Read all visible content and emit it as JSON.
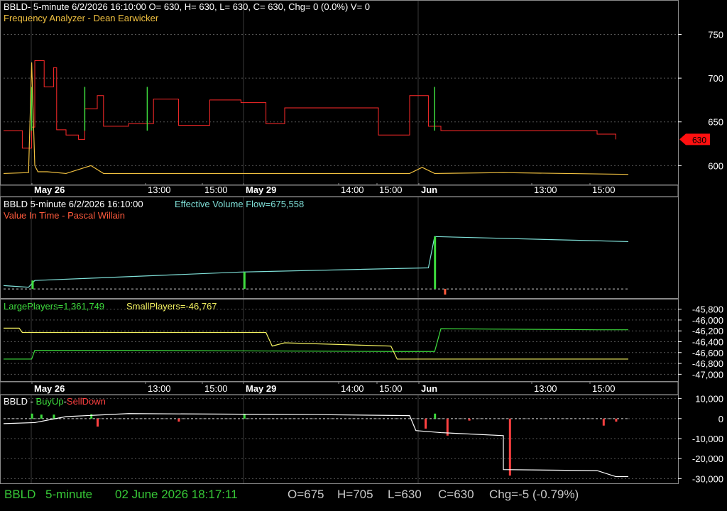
{
  "colors": {
    "background": "#000000",
    "frequency_red": "#ff2a2a",
    "frequency_green": "#3ddc3d",
    "frequency_yellow": "#f0c040",
    "flow_cyan": "#7fe0d8",
    "flow_green": "#3ddc3d",
    "flow_white": "#ffffff",
    "vit_red": "#ff5a3c",
    "large_green": "#3ddc3d",
    "small_yellow": "#f2f060",
    "buy_green": "#3ddc3d",
    "sell_red": "#ff4040",
    "status_green": "#37c837",
    "status_gray": "#c8c8c8",
    "price_tag": "#ff1010"
  },
  "panel1": {
    "title": "BBLD- 5-minute 6/2/2026 16:10:00 O= 630, H= 630, L= 630, C= 630, Chg= 0 (0.0%) V= 0",
    "indicator": "Frequency Analyzer - Dean Earwicker",
    "price_tag": "630"
  },
  "panel2": {
    "symbol": "BBLD 5-minute  6/2/2026 16:10:00",
    "flow": "Effective Volume Flow=675,558",
    "indicator": "Value In Time - Pascal Willain"
  },
  "panel3": {
    "large": "LargePlayers=1,361,749",
    "small": "SmallPlayers=-46,767"
  },
  "panel4": {
    "symbol": "BBLD -",
    "buy": "BuyUp",
    "dash": "-",
    "sell": "SellDown"
  },
  "time_axis": [
    "May 26",
    "13:00",
    "15:00",
    "May 29",
    "14:00",
    "15:00",
    "Jun",
    "13:00",
    "15:00"
  ],
  "status": {
    "symbol": "BBLD",
    "interval": "5-minute",
    "datetime": "02 June 2026 18:17:11",
    "open": "O=675",
    "high": "H=705",
    "low": "L=630",
    "close": "C=630",
    "change": "Chg=-5 (-0.79%)"
  },
  "chart_data": [
    {
      "type": "line",
      "title": "Frequency Analyzer - Dean Earwicker",
      "y_ticks": [
        "750",
        "700",
        "650",
        "600"
      ],
      "ylim": [
        580,
        765
      ],
      "series": [
        {
          "values_over_time": [
            [
              0,
              640
            ],
            [
              0.03,
              620
            ],
            [
              0.045,
              644
            ],
            [
              0.05,
              720
            ],
            [
              0.065,
              690
            ],
            [
              0.08,
              712
            ],
            [
              0.085,
              641
            ],
            [
              0.1,
              635
            ],
            [
              0.12,
              630
            ],
            [
              0.13,
              665
            ],
            [
              0.15,
              680
            ],
            [
              0.16,
              645
            ],
            [
              0.2,
              648
            ],
            [
              0.24,
              676
            ],
            [
              0.28,
              646
            ],
            [
              0.33,
              675
            ],
            [
              0.38,
              672
            ],
            [
              0.42,
              648
            ],
            [
              0.45,
              666
            ],
            [
              0.55,
              666
            ],
            [
              0.6,
              635
            ],
            [
              0.65,
              680
            ],
            [
              0.68,
              645
            ],
            [
              0.7,
              640
            ],
            [
              0.95,
              636
            ],
            [
              0.98,
              630
            ]
          ]
        },
        {
          "values_over_time": [
            [
              0,
              591
            ],
            [
              0.04,
              592
            ],
            [
              0.045,
              718
            ],
            [
              0.05,
              600
            ],
            [
              0.055,
              593
            ],
            [
              0.07,
              593
            ],
            [
              0.1,
              591
            ],
            [
              0.14,
              600
            ],
            [
              0.16,
              591
            ],
            [
              0.3,
              591
            ],
            [
              0.65,
              591
            ],
            [
              0.67,
              598
            ],
            [
              0.69,
              591
            ],
            [
              0.8,
              592
            ],
            [
              1.0,
              590
            ]
          ]
        }
      ]
    },
    {
      "type": "line",
      "title": "Effective Volume Flow=675,558",
      "series": [
        {
          "values_over_time": [
            [
              0,
              0.14
            ],
            [
              0.04,
              0.12
            ],
            [
              0.05,
              0.2
            ],
            [
              0.15,
              0.23
            ],
            [
              0.38,
              0.3
            ],
            [
              0.68,
              0.35
            ],
            [
              0.69,
              0.72
            ],
            [
              0.95,
              0.67
            ],
            [
              1.0,
              0.66
            ]
          ]
        }
      ]
    },
    {
      "type": "line",
      "title": "LargePlayers / SmallPlayers",
      "y_ticks": [
        "-45,800",
        "-46,000",
        "-46,200",
        "-46,400",
        "-46,600",
        "-46,800",
        "-47,000"
      ],
      "ylim": [
        -47100,
        -45700
      ],
      "series": [
        {
          "values_over_time": [
            [
              0,
              -46720
            ],
            [
              0.045,
              -46720
            ],
            [
              0.05,
              -46560
            ],
            [
              0.2,
              -46560
            ],
            [
              0.63,
              -46580
            ],
            [
              0.69,
              -46580
            ],
            [
              0.7,
              -46160
            ],
            [
              0.95,
              -46180
            ],
            [
              1.0,
              -46180
            ]
          ]
        },
        {
          "values_over_time": [
            [
              0,
              -46150
            ],
            [
              0.025,
              -46150
            ],
            [
              0.03,
              -46230
            ],
            [
              0.42,
              -46230
            ],
            [
              0.43,
              -46480
            ],
            [
              0.45,
              -46420
            ],
            [
              0.62,
              -46480
            ],
            [
              0.63,
              -46720
            ],
            [
              1.0,
              -46720
            ]
          ]
        }
      ]
    },
    {
      "type": "line",
      "title": "BBLD - BuyUp-SellDown",
      "y_ticks": [
        "10,000",
        "0",
        "-10,000",
        "-20,000",
        "-30,000"
      ],
      "ylim": [
        -32000,
        12000
      ],
      "series": [
        {
          "values_over_time": [
            [
              0,
              -2500
            ],
            [
              0.05,
              -2000
            ],
            [
              0.1,
              1000
            ],
            [
              0.2,
              2500
            ],
            [
              0.5,
              2000
            ],
            [
              0.65,
              1500
            ],
            [
              0.66,
              -6000
            ],
            [
              0.7,
              -7000
            ],
            [
              0.8,
              -8500
            ],
            [
              0.8,
              -25500
            ],
            [
              0.95,
              -26000
            ],
            [
              0.98,
              -29000
            ],
            [
              1.0,
              -29000
            ]
          ]
        }
      ]
    }
  ]
}
